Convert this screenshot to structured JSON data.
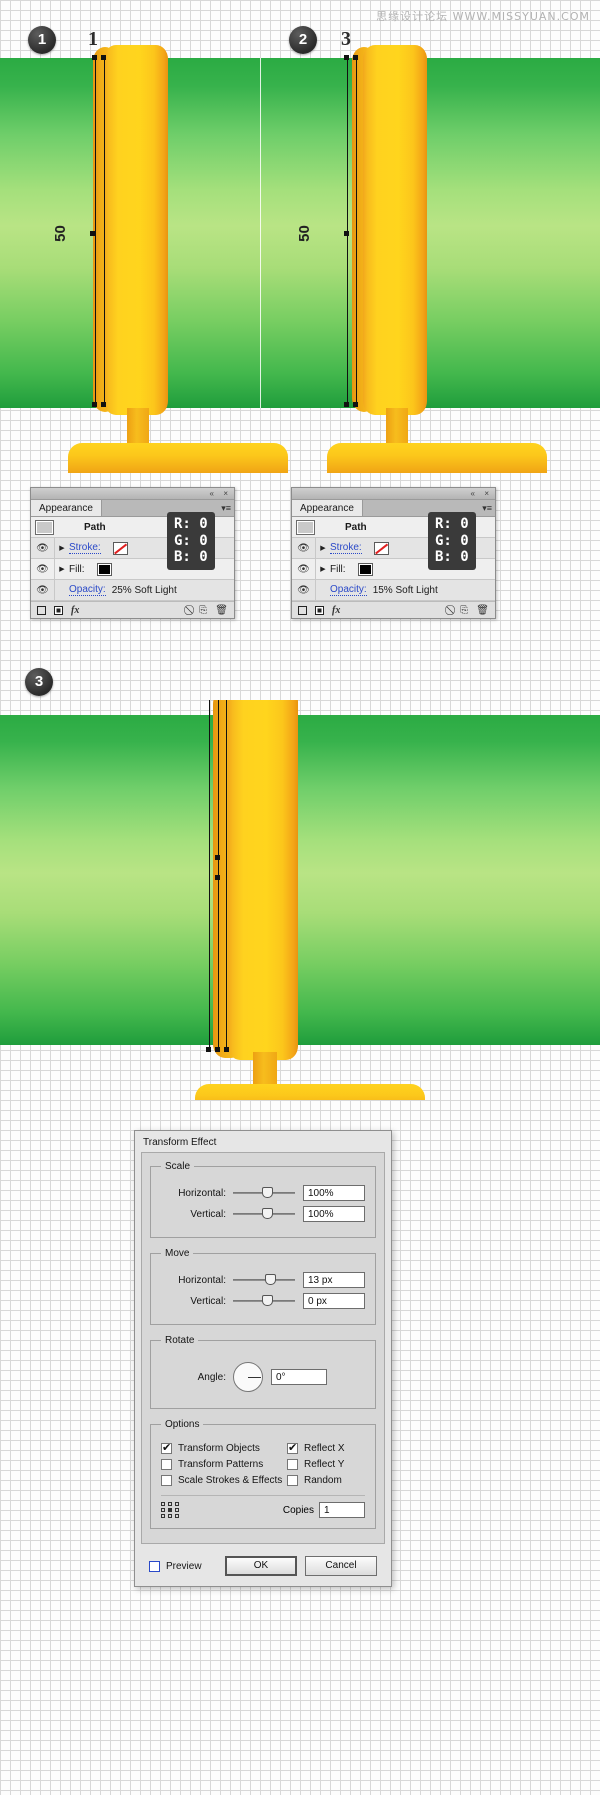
{
  "watermark": "思缘设计论坛 WWW.MISSYUAN.COM",
  "steps": [
    {
      "badge": "1",
      "label": "1"
    },
    {
      "badge": "2",
      "label": "3"
    },
    {
      "badge": "3",
      "label": ""
    }
  ],
  "canvas": {
    "rotated_value_1": "50",
    "rotated_value_2": "50"
  },
  "panels": [
    {
      "tab": "Appearance",
      "collapse_icon": "«",
      "close_icon": "×",
      "menu_icon": "▾≡",
      "item_label": "Path",
      "rows": [
        {
          "label": "Stroke:",
          "swatch": "none",
          "eye": "visible",
          "arrow": "▶"
        },
        {
          "label": "Fill:",
          "swatch": "black",
          "eye": "visible",
          "arrow": "▶"
        }
      ],
      "opacity_label": "Opacity:",
      "opacity_value": "25% Soft Light",
      "footer_icons": [
        "new-fill-icon",
        "new-stroke-icon",
        "fx-icon",
        "clear-icon",
        "duplicate-icon",
        "delete-icon"
      ],
      "fx_label": "fx",
      "tooltip": {
        "r": "R: 0",
        "g": "G: 0",
        "b": "B: 0"
      }
    },
    {
      "tab": "Appearance",
      "collapse_icon": "«",
      "close_icon": "×",
      "menu_icon": "▾≡",
      "item_label": "Path",
      "rows": [
        {
          "label": "Stroke:",
          "swatch": "none",
          "eye": "visible",
          "arrow": "▶"
        },
        {
          "label": "Fill:",
          "swatch": "black",
          "eye": "visible",
          "arrow": "▶"
        }
      ],
      "opacity_label": "Opacity:",
      "opacity_value": "15% Soft Light",
      "footer_icons": [
        "new-fill-icon",
        "new-stroke-icon",
        "fx-icon",
        "clear-icon",
        "duplicate-icon",
        "delete-icon"
      ],
      "fx_label": "fx",
      "tooltip": {
        "r": "R: 0",
        "g": "G: 0",
        "b": "B: 0"
      }
    }
  ],
  "dialog": {
    "title": "Transform Effect",
    "scale": {
      "legend": "Scale",
      "horizontal_label": "Horizontal:",
      "horizontal_value": "100%",
      "vertical_label": "Vertical:",
      "vertical_value": "100%"
    },
    "move": {
      "legend": "Move",
      "horizontal_label": "Horizontal:",
      "horizontal_value": "13 px",
      "vertical_label": "Vertical:",
      "vertical_value": "0 px"
    },
    "rotate": {
      "legend": "Rotate",
      "angle_label": "Angle:",
      "angle_value": "0°"
    },
    "options": {
      "legend": "Options",
      "left": [
        {
          "label": "Transform Objects",
          "checked": true
        },
        {
          "label": "Transform Patterns",
          "checked": false
        },
        {
          "label": "Scale Strokes & Effects",
          "checked": false
        }
      ],
      "right": [
        {
          "label": "Reflect X",
          "checked": true
        },
        {
          "label": "Reflect Y",
          "checked": false
        },
        {
          "label": "Random",
          "checked": false
        }
      ],
      "copies_label": "Copies",
      "copies_value": "1"
    },
    "preview_label": "Preview",
    "preview_checked": false,
    "ok_label": "OK",
    "cancel_label": "Cancel"
  },
  "colors": {
    "green_dark": "#2bab43",
    "green_light": "#b9e485",
    "yellow": "#ffd21f",
    "orange": "#e8940f",
    "badge": "#2b2b2b",
    "link": "#2a49c8"
  }
}
